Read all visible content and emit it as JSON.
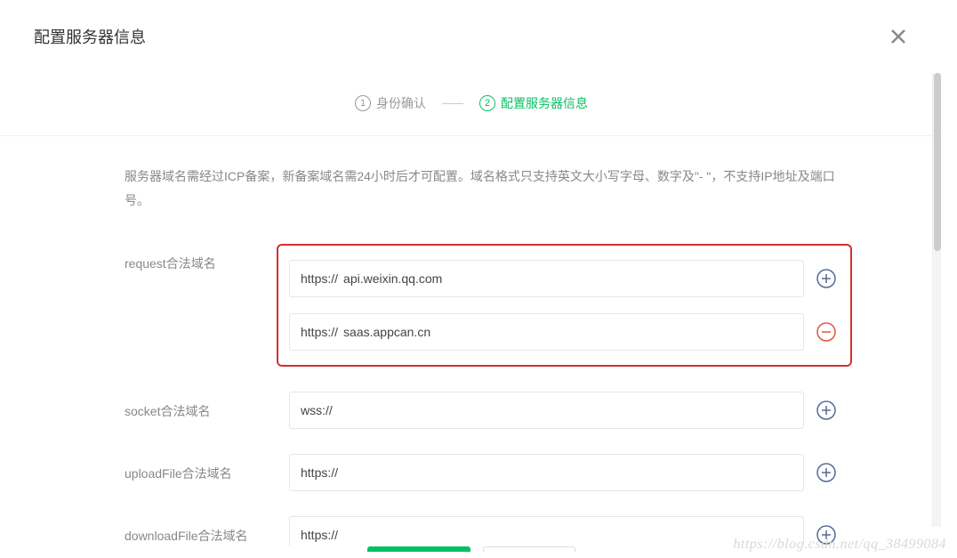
{
  "modal": {
    "title": "配置服务器信息"
  },
  "steps": {
    "1": {
      "num": "1",
      "label": "身份确认"
    },
    "2": {
      "num": "2",
      "label": "配置服务器信息"
    }
  },
  "description": "服务器域名需经过ICP备案，新备案域名需24小时后才可配置。域名格式只支持英文大小写字母、数字及\"- \"，不支持IP地址及端口号。",
  "fields": {
    "request": {
      "label": "request合法域名",
      "rows": [
        {
          "prefix": "https://",
          "value": "api.weixin.qq.com"
        },
        {
          "prefix": "https://",
          "value": "saas.appcan.cn"
        }
      ]
    },
    "socket": {
      "label": "socket合法域名",
      "rows": [
        {
          "prefix": "wss://",
          "value": ""
        }
      ]
    },
    "uploadFile": {
      "label": "uploadFile合法域名",
      "rows": [
        {
          "prefix": "https://",
          "value": ""
        }
      ]
    },
    "downloadFile": {
      "label": "downloadFile合法域名",
      "rows": [
        {
          "prefix": "https://",
          "value": ""
        }
      ]
    }
  },
  "watermark": "https://blog.csdn.net/qq_38499084"
}
